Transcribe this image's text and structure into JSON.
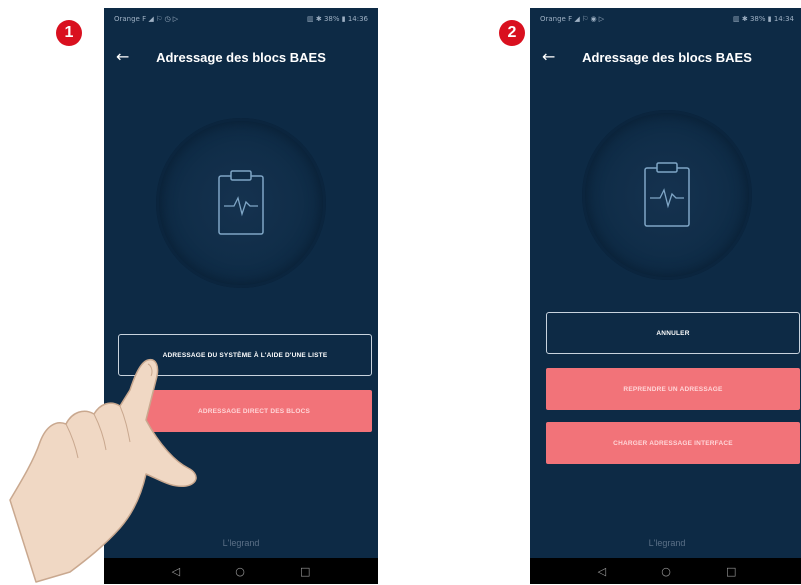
{
  "step_badges": [
    "1",
    "2"
  ],
  "screens": [
    {
      "status_left": "Orange F  ◢ ⚐ ◷ ▷",
      "status_right": "▥ ✱ 38% ▮ 14:36",
      "title": "Adressage des blocs BAES",
      "buttons": [
        {
          "label": "ADRESSAGE DU SYSTÈME À L'AIDE D'UNE LISTE",
          "style": "outline"
        },
        {
          "label": "ADRESSAGE DIRECT DES BLOCS",
          "style": "filled"
        }
      ],
      "footer": "L'legrand"
    },
    {
      "status_left": "Orange F  ◢ ⚐ ◉ ▷",
      "status_right": "▥ ✱ 38% ▮ 14:34",
      "title": "Adressage des blocs BAES",
      "buttons": [
        {
          "label": "ANNULER",
          "style": "outline"
        },
        {
          "label": "REPRENDRE UN ADRESSAGE",
          "style": "filled"
        },
        {
          "label": "CHARGER ADRESSAGE INTERFACE",
          "style": "filled"
        }
      ],
      "footer": "L'legrand"
    }
  ],
  "nav_icons": [
    "back-triangle",
    "home-circle",
    "recents-square"
  ],
  "colors": {
    "background": "#0d2a45",
    "accent": "#f27379",
    "badge": "#d9101f"
  }
}
